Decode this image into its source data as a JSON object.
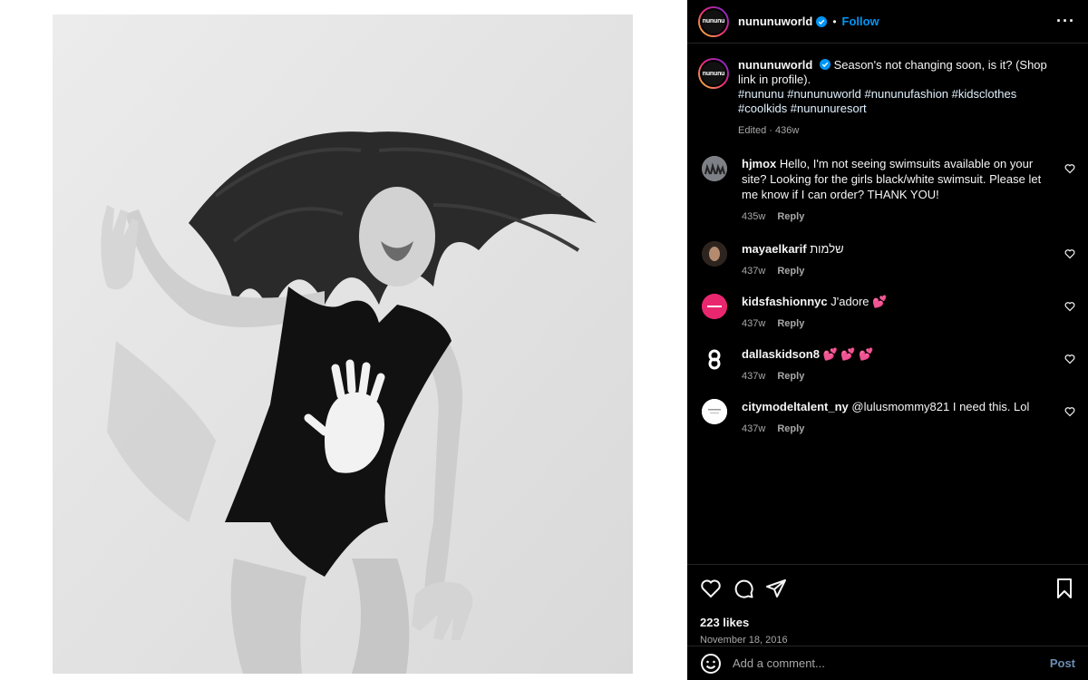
{
  "header": {
    "avatar_text": "nununu",
    "username": "nununuworld",
    "separator": "•",
    "follow_label": "Follow",
    "more_label": "···"
  },
  "caption": {
    "username": "nununuworld",
    "text": "Season's not changing soon, is it? (Shop link in profile).",
    "tags": "#nununu #nununuworld #nununufashion #kidsclothes #coolkids #nununuresort",
    "meta": "Edited · 436w"
  },
  "comments": [
    {
      "username": "hjmox",
      "text": "Hello, I'm not seeing swimsuits available on your site? Looking for the girls black/white swimsuit. Please let me know if I can order? THANK YOU!",
      "age": "435w",
      "reply": "Reply"
    },
    {
      "username": "mayaelkarif",
      "text": "שלמות",
      "age": "437w",
      "reply": "Reply"
    },
    {
      "username": "kidsfashionnyc",
      "text": "J'adore",
      "emoji": "💕",
      "age": "437w",
      "reply": "Reply"
    },
    {
      "username": "dallaskidson8",
      "text": "",
      "emoji": "💕 💕 💕",
      "age": "437w",
      "reply": "Reply"
    },
    {
      "username": "citymodeltalent_ny",
      "text": "@lulusmommy821 I need this. Lol",
      "age": "437w",
      "reply": "Reply"
    }
  ],
  "footer": {
    "likes": "223 likes",
    "date": "November 18, 2016",
    "add_placeholder": "Add a comment...",
    "post_label": "Post"
  },
  "colors": {
    "accent": "#0095f6",
    "panel_bg": "#000000",
    "muted": "#a8a8a8"
  },
  "icons": [
    "verified-icon",
    "like-icon",
    "comment-icon",
    "share-icon",
    "save-icon",
    "emoji-icon",
    "small-heart-icon"
  ]
}
